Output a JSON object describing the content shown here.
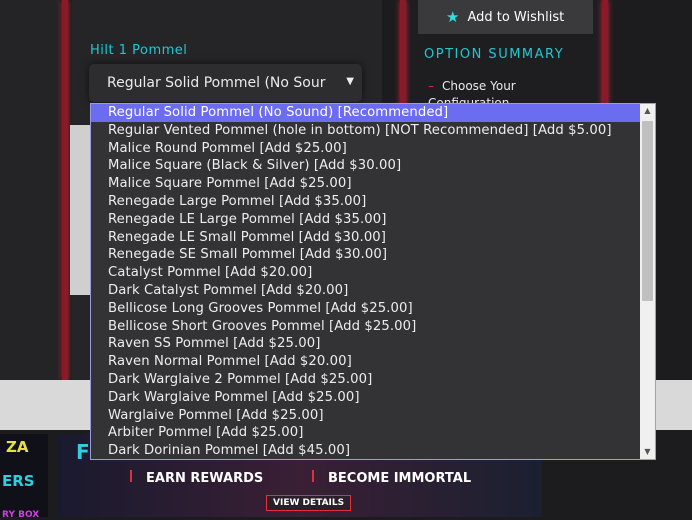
{
  "field": {
    "label": "Hilt 1 Pommel",
    "value": "Regular Solid Pommel (No Sour",
    "caret": "▼"
  },
  "sidebar": {
    "wishlist_label": "Add to Wishlist",
    "wishlist_icon": "★",
    "summary_title": "OPTION SUMMARY",
    "summary_item": "Choose Your Configuration",
    "summary_dash": "–"
  },
  "options": [
    "Regular Solid Pommel (No Sound) [Recommended]",
    "Regular Vented Pommel (hole in bottom) [NOT Recommended] [Add $5.00]",
    "Malice Round Pommel [Add $25.00]",
    "Malice Square (Black & Silver) [Add $30.00]",
    "Malice Square Pommel [Add $25.00]",
    "Renegade Large Pommel [Add $35.00]",
    "Renegade LE Large Pommel [Add $35.00]",
    "Renegade LE Small Pommel [Add $30.00]",
    "Renegade SE Small Pommel [Add $30.00]",
    "Catalyst Pommel [Add $20.00]",
    "Dark Catalyst Pommel [Add $20.00]",
    "Bellicose Long Grooves Pommel [Add $25.00]",
    "Bellicose Short Grooves Pommel [Add $25.00]",
    "Raven SS Pommel [Add $25.00]",
    "Raven Normal Pommel [Add $20.00]",
    "Dark Warglaive 2 Pommel [Add $25.00]",
    "Dark Warglaive Pommel [Add $25.00]",
    "Warglaive Pommel [Add $25.00]",
    "Arbiter Pommel [Add $25.00]",
    "Dark Dorinian Pommel [Add $45.00]"
  ],
  "selected_index": 0,
  "scroll": {
    "up": "▲",
    "down": "▼"
  },
  "banner": {
    "f": "F",
    "earn": "EARN REWARDS",
    "become": "BECOME IMMORTAL",
    "details": "VIEW DETAILS"
  },
  "thumb_left": {
    "t1": "ZA",
    "t2": "ERS",
    "t3": "RY BOX"
  },
  "colors": {
    "accent": "#22c7cf",
    "selected": "#6c6cf0",
    "red": "#e0303a"
  }
}
